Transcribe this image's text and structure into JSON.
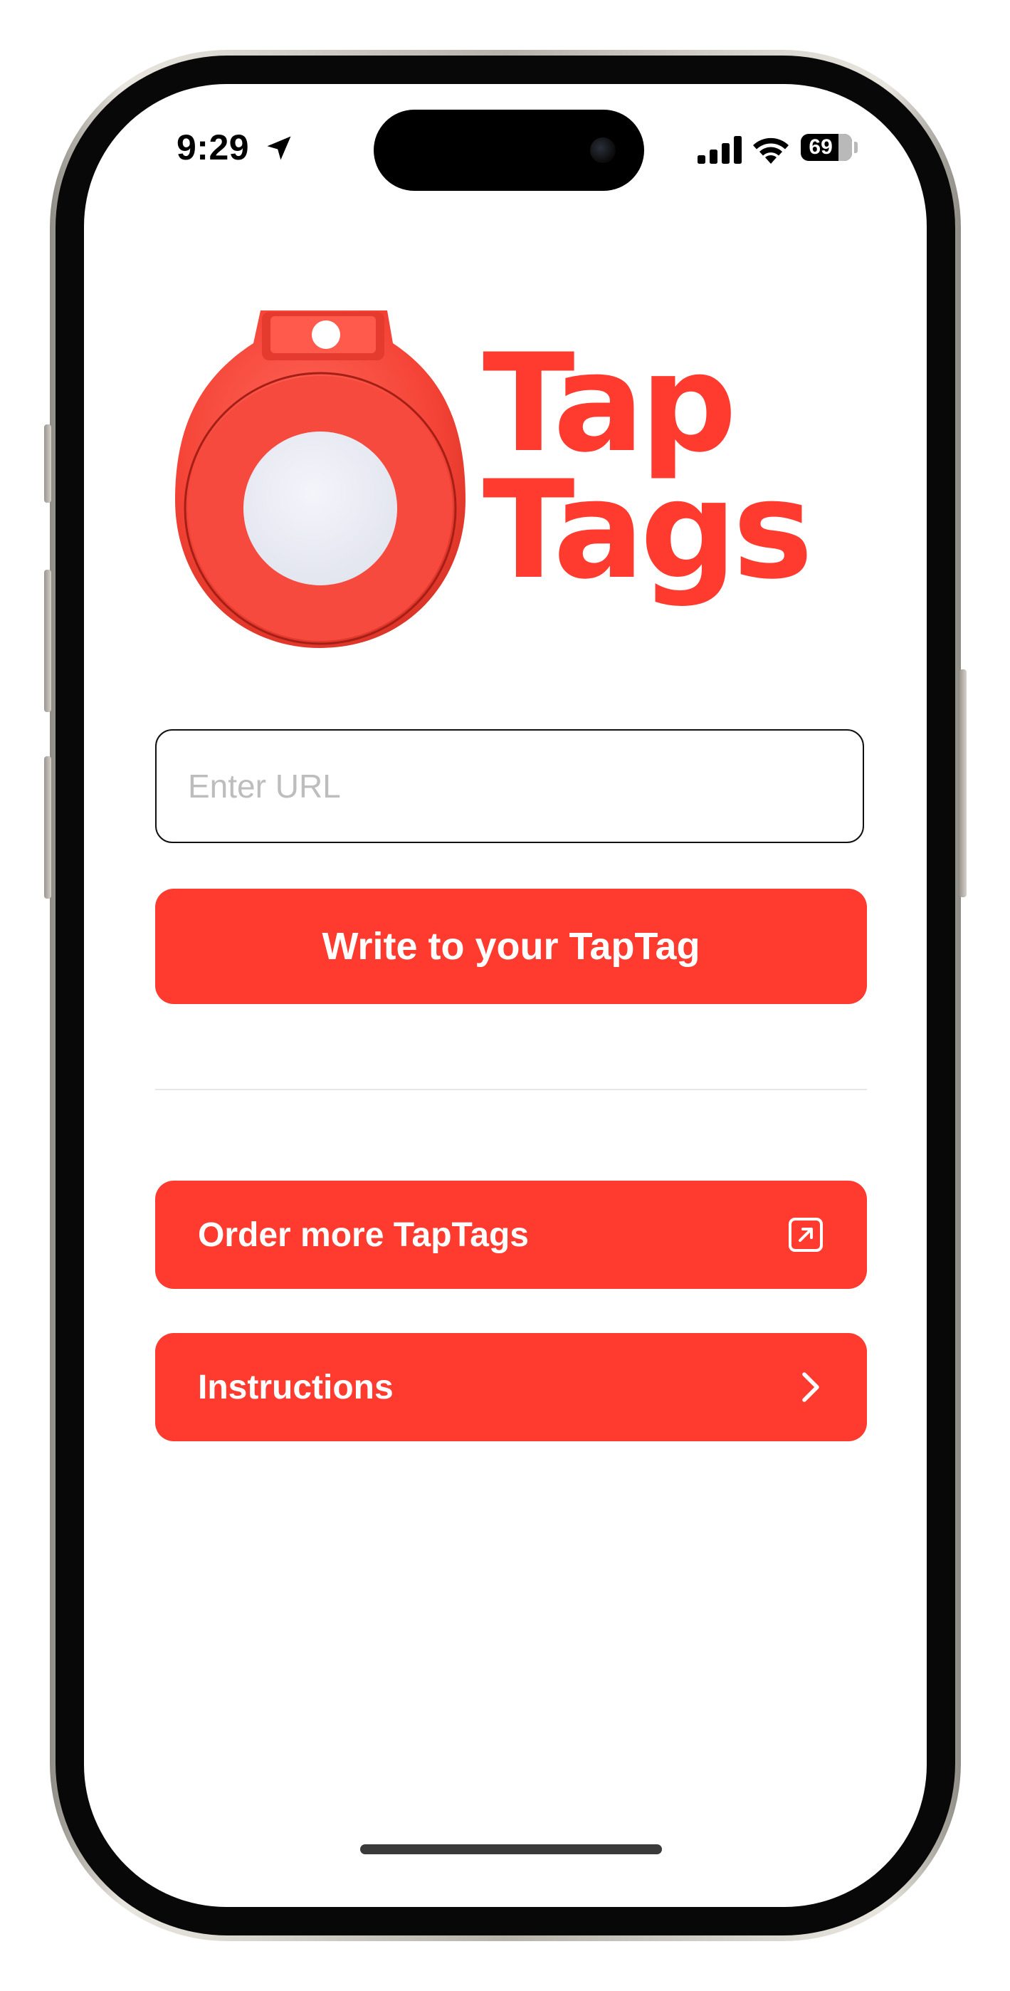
{
  "status_bar": {
    "time": "9:29",
    "battery_level": "69",
    "location_icon": "location-arrow-icon",
    "signal_icon": "cellular-signal-icon",
    "wifi_icon": "wifi-icon"
  },
  "logo": {
    "line1": "Tap",
    "line2": "Tags",
    "brand_color": "#ff3b30"
  },
  "url_input": {
    "value": "",
    "placeholder": "Enter URL"
  },
  "write_button": {
    "label": "Write to your TapTag"
  },
  "order_button": {
    "label": "Order more TapTags",
    "icon": "external-link-icon"
  },
  "instructions_button": {
    "label": "Instructions",
    "icon": "chevron-right-icon"
  }
}
